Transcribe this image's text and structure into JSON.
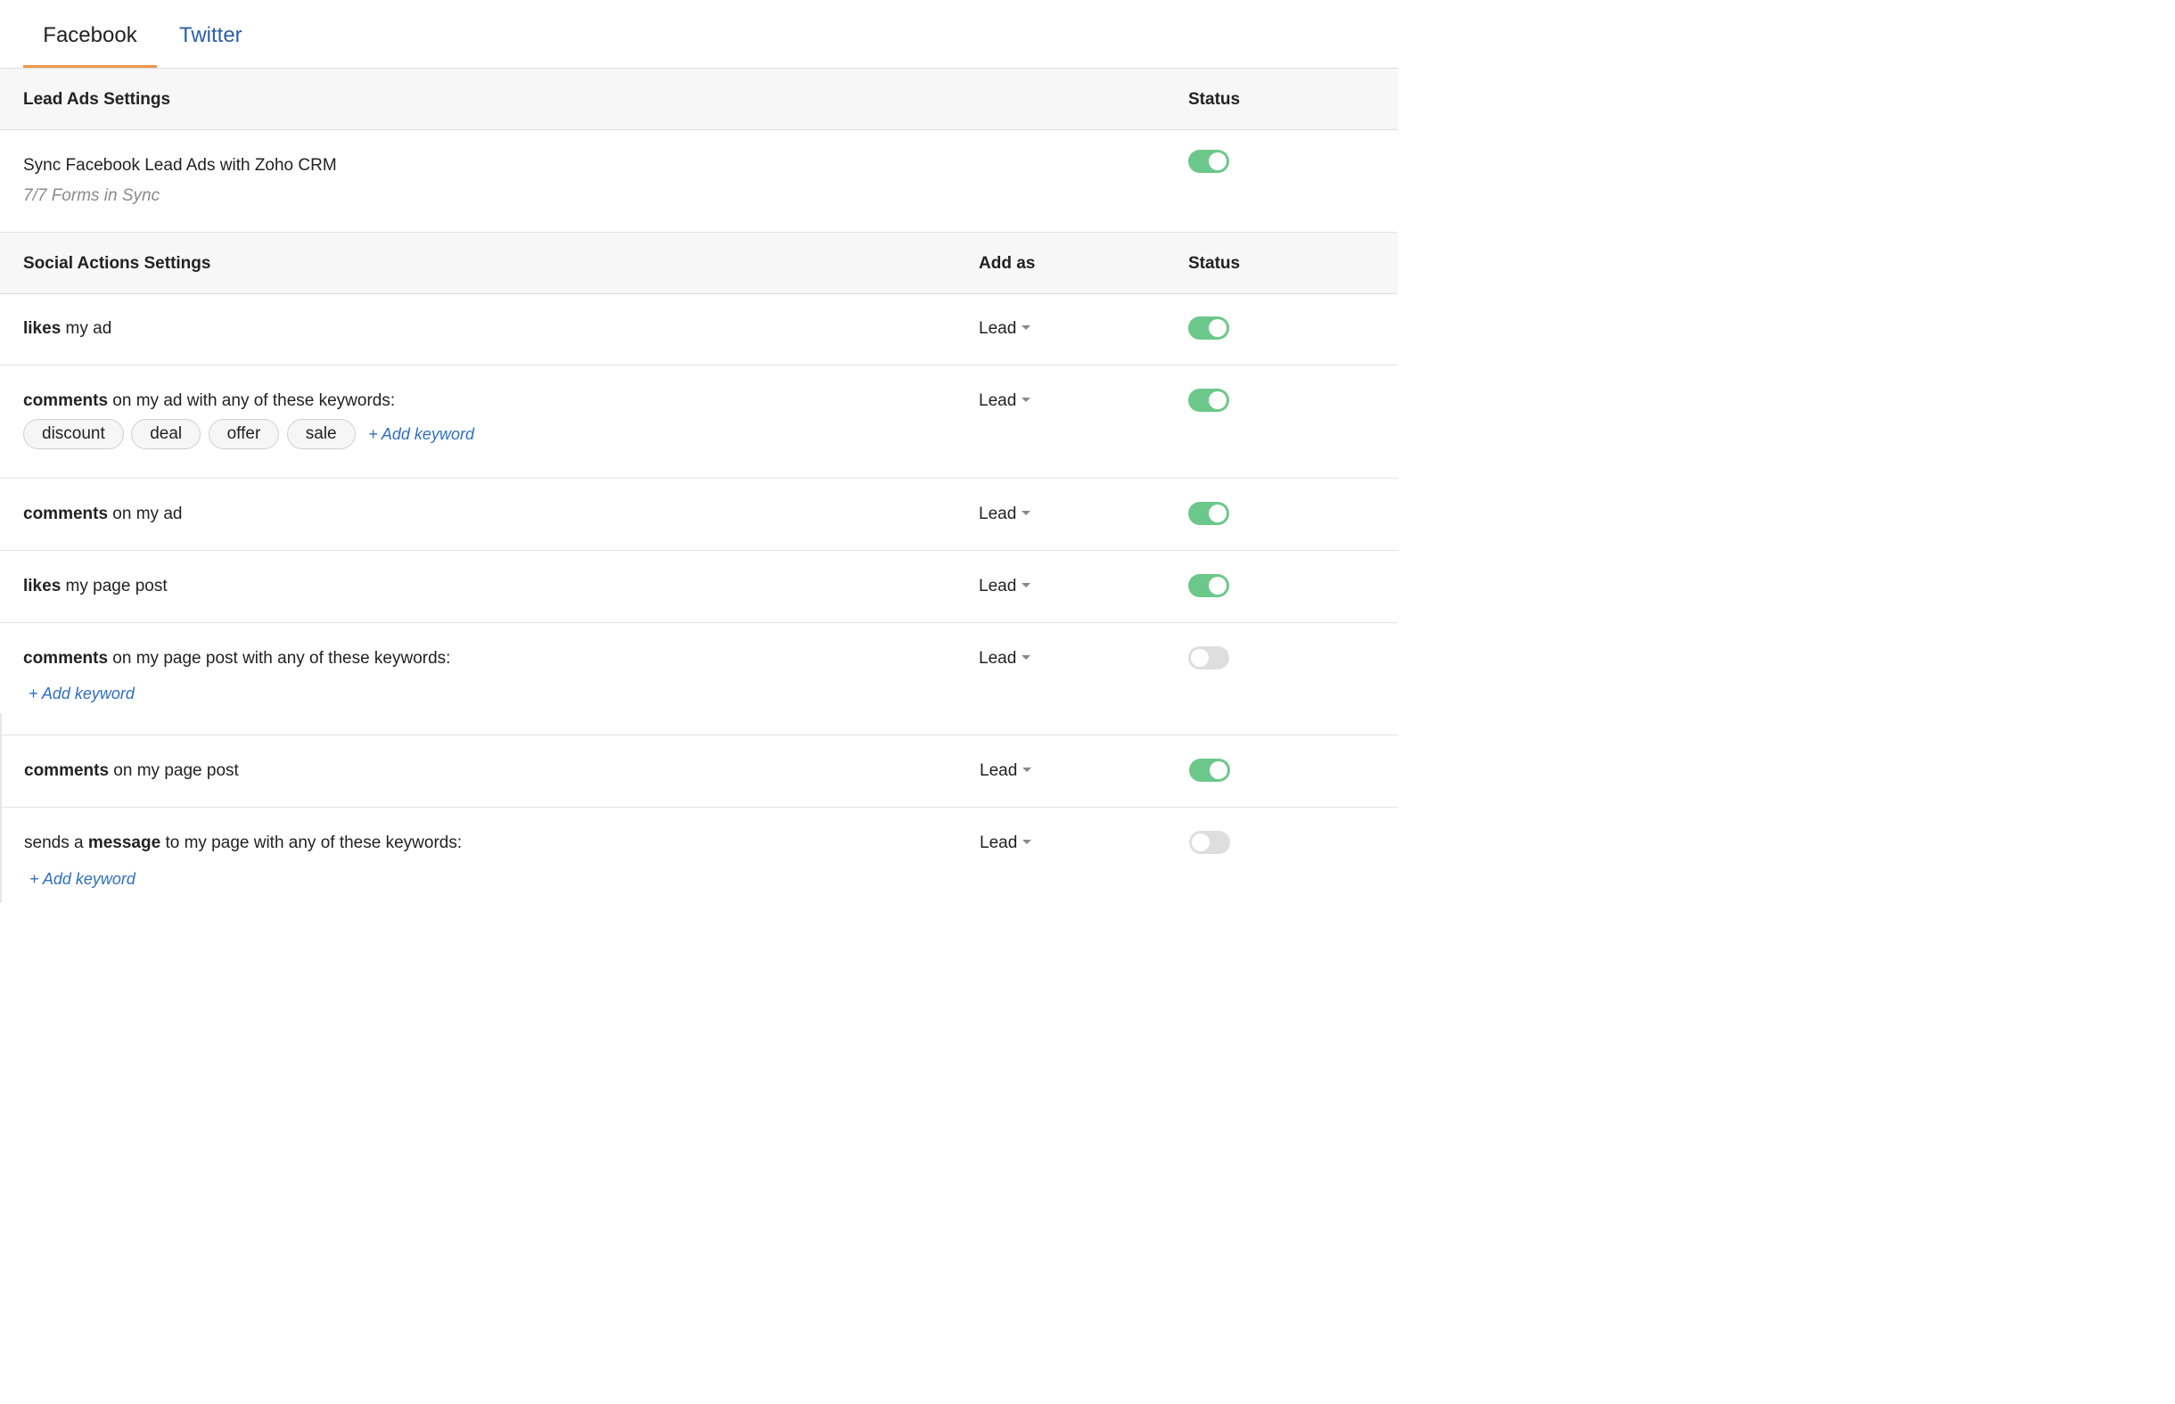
{
  "tabs": [
    {
      "label": "Facebook",
      "active": true
    },
    {
      "label": "Twitter",
      "active": false
    }
  ],
  "lead_ads": {
    "header": "Lead Ads Settings",
    "status_header": "Status",
    "row": {
      "label": "Sync Facebook Lead Ads with Zoho CRM",
      "subtitle": "7/7 Forms in Sync",
      "status": "on"
    }
  },
  "social_actions": {
    "header": "Social Actions Settings",
    "add_as_header": "Add as",
    "status_header": "Status",
    "rows": [
      {
        "pre": "",
        "bold": "likes",
        "post": " my ad",
        "add_as": "Lead",
        "status": "on"
      },
      {
        "pre": "",
        "bold": "comments",
        "post": " on my ad with any of these keywords:",
        "add_as": "Lead",
        "status": "on",
        "keywords": [
          "discount",
          "deal",
          "offer",
          "sale"
        ],
        "add_keyword": "+ Add keyword"
      },
      {
        "pre": "",
        "bold": "comments",
        "post": " on my ad",
        "add_as": "Lead",
        "status": "on"
      },
      {
        "pre": "",
        "bold": "likes",
        "post": " my page post",
        "add_as": "Lead",
        "status": "on"
      },
      {
        "pre": "",
        "bold": "comments",
        "post": " on my page post with any of these keywords:",
        "add_as": "Lead",
        "status": "off",
        "add_keyword": "+ Add keyword"
      },
      {
        "pre": "",
        "bold": "comments",
        "post": " on my page post",
        "add_as": "Lead",
        "status": "on"
      },
      {
        "pre": "sends a ",
        "bold": "message",
        "post": " to my page with any of these keywords:",
        "add_as": "Lead",
        "status": "off",
        "add_keyword": "+ Add keyword"
      }
    ]
  },
  "colors": {
    "toggle_on": "#6cc88a",
    "toggle_off": "#dedede",
    "tab_accent": "#f0994a",
    "link": "#2f6fc0"
  }
}
